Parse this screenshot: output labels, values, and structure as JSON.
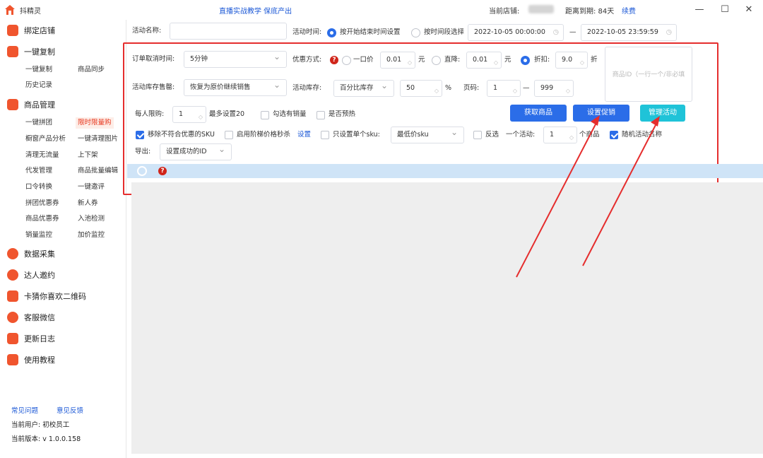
{
  "titlebar": {
    "app_title": "抖精灵",
    "promo": "直播实战教学 保底产出",
    "shop_label": "当前店铺:",
    "expire_label": "距离到期:  84天",
    "renew": "续费",
    "min": "—",
    "max": "☐",
    "close": "✕"
  },
  "sidebar": {
    "sections": [
      {
        "label": "绑定店铺",
        "color": "#f0552e"
      },
      {
        "label": "一键复制",
        "color": "#f0552e"
      },
      {
        "label": "商品管理",
        "color": "#f0552e"
      },
      {
        "label": "数据采集",
        "color": "#f0552e"
      },
      {
        "label": "达人邀约",
        "color": "#f0552e"
      },
      {
        "label": "卡猜你喜欢二维码",
        "color": "#f0552e"
      },
      {
        "label": "客服微信",
        "color": "#f0552e"
      },
      {
        "label": "更新日志",
        "color": "#f0552e"
      },
      {
        "label": "使用教程",
        "color": "#f0552e"
      }
    ],
    "copy_items": [
      "一键复制",
      "商品同步",
      "历史记录"
    ],
    "manage_items": [
      "一键拼团",
      "限时限量购",
      "橱窗产品分析",
      "一键清理图片",
      "清理无流量",
      "上下架",
      "代发管理",
      "商品批量编辑",
      "口令转换",
      "一键邀评",
      "拼团优惠券",
      "新人券",
      "商品优惠券",
      "入池检测",
      "销量监控",
      "加价监控"
    ],
    "faq": "常见问题",
    "feedback": "意见反馈",
    "user": "当前用户: 初校员工",
    "version": "当前版本: v 1.0.0.158"
  },
  "form": {
    "activity_name_label": "活动名称:",
    "activity_name_value": "",
    "activity_time_label": "活动时间:",
    "time_opt1": "按开始结束时间设置",
    "time_opt2": "按时间段选择",
    "start_time": "2022-10-05 00:00:00",
    "dash": "—",
    "end_time": "2022-10-05 23:59:59",
    "cancel_label": "订单取消时间:",
    "cancel_value": "5分钟",
    "discount_label": "优惠方式:",
    "one_price": "一口价",
    "one_price_value": "0.01",
    "yuan1": "元",
    "direct_cut": "直降:",
    "direct_value": "0.01",
    "yuan2": "元",
    "rebate": "折扣:",
    "rebate_value": "9.0",
    "zhe": "折",
    "product_id_placeholder": "商品ID（一行一个/非必填",
    "stock_sold_label": "活动库存售罄:",
    "stock_sold_value": "恢复为原价继续销售",
    "stock_label": "活动库存:",
    "stock_mode": "百分比库存",
    "stock_value": "50",
    "percent": "%",
    "page_label": "页码:",
    "page_from": "1",
    "page_dash": "—",
    "page_to": "999",
    "limit_label": "每人限购:",
    "limit_value": "1",
    "limit_max": "最多设置20",
    "check_sales": "勾选有销量",
    "check_presale": "是否预热",
    "btn_get": "获取商品",
    "btn_set": "设置促销",
    "btn_manage": "管理活动",
    "remove_sku": "移除不符合优惠的SKU",
    "ladder": "启用阶梯价格秒杀",
    "ladder_set": "设置",
    "single_sku": "只设置单个sku:",
    "single_sku_value": "最低价sku",
    "reverse": "反选",
    "per_activity": "一个活动:",
    "per_activity_value": "1",
    "per_activity_unit": "个商品",
    "random_name": "随机活动名称",
    "export_label": "导出:",
    "export_value": "设置成功的ID"
  },
  "colors": {
    "accent": "#2b6de8",
    "manage_btn": "#1fc3d8",
    "alert": "#e52d2d"
  }
}
